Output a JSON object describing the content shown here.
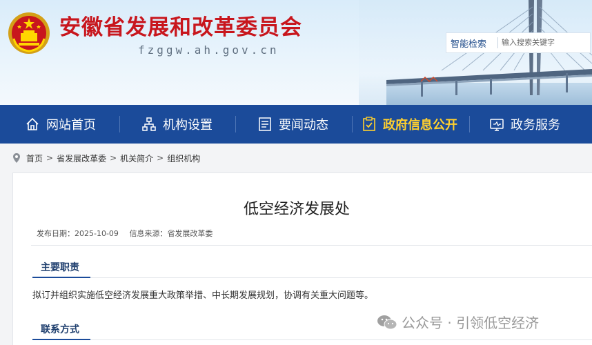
{
  "header": {
    "site_title": "安徽省发展和改革委员会",
    "site_domain": "fzggw.ah.gov.cn",
    "search_label": "智能检索",
    "search_placeholder": "输入搜索关键字"
  },
  "nav": {
    "items": [
      {
        "label": "网站首页",
        "icon": "home-icon"
      },
      {
        "label": "机构设置",
        "icon": "org-chart-icon"
      },
      {
        "label": "要闻动态",
        "icon": "news-icon"
      },
      {
        "label": "政府信息公开",
        "icon": "info-disclosure-icon",
        "active": true
      },
      {
        "label": "政务服务",
        "icon": "service-icon"
      }
    ],
    "active_color": "#ffd02e",
    "bg_color": "#1b4b9a"
  },
  "breadcrumb": {
    "icon": "location-pin-icon",
    "items": [
      "首页",
      "省发展改革委",
      "机关简介",
      "组织机构"
    ],
    "separator": ">"
  },
  "article": {
    "title": "低空经济发展处",
    "publish_date_label": "发布日期：",
    "publish_date": "2025-10-09",
    "source_label": "信息来源：",
    "source": "省发展改革委",
    "sections": [
      {
        "heading": "主要职责",
        "text": "拟订并组织实施低空经济发展重大政策举措、中长期发展规划，协调有关重大问题等。"
      },
      {
        "heading": "联系方式",
        "text": ""
      }
    ]
  },
  "watermark": {
    "icon": "wechat-icon",
    "text": "公众号 · 引领低空经济"
  }
}
